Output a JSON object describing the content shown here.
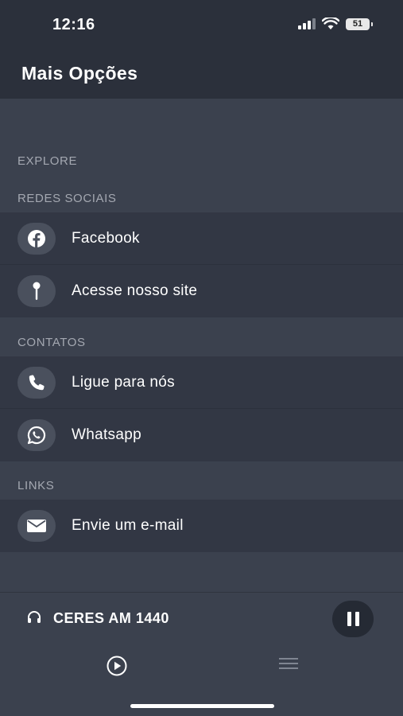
{
  "status_bar": {
    "time": "12:16",
    "battery": "51"
  },
  "header": {
    "title": "Mais Opções"
  },
  "sections": {
    "explore": "EXPLORE",
    "social": "REDES SOCIAIS",
    "contacts": "CONTATOS",
    "links": "LINKS"
  },
  "menu": {
    "facebook": {
      "label": "Facebook",
      "icon": "facebook-icon"
    },
    "site": {
      "label": "Acesse nosso site",
      "icon": "pin-icon"
    },
    "call": {
      "label": "Ligue para nós",
      "icon": "phone-icon"
    },
    "whatsapp": {
      "label": "Whatsapp",
      "icon": "whatsapp-icon"
    },
    "email": {
      "label": "Envie um e-mail",
      "icon": "mail-icon"
    }
  },
  "player": {
    "station": "CERES AM 1440",
    "state": "playing"
  },
  "colors": {
    "background": "#3b414e",
    "header": "#2b303b",
    "item": "#323744",
    "icon_circle": "#4a505d",
    "section_text": "#a4a8b1"
  }
}
